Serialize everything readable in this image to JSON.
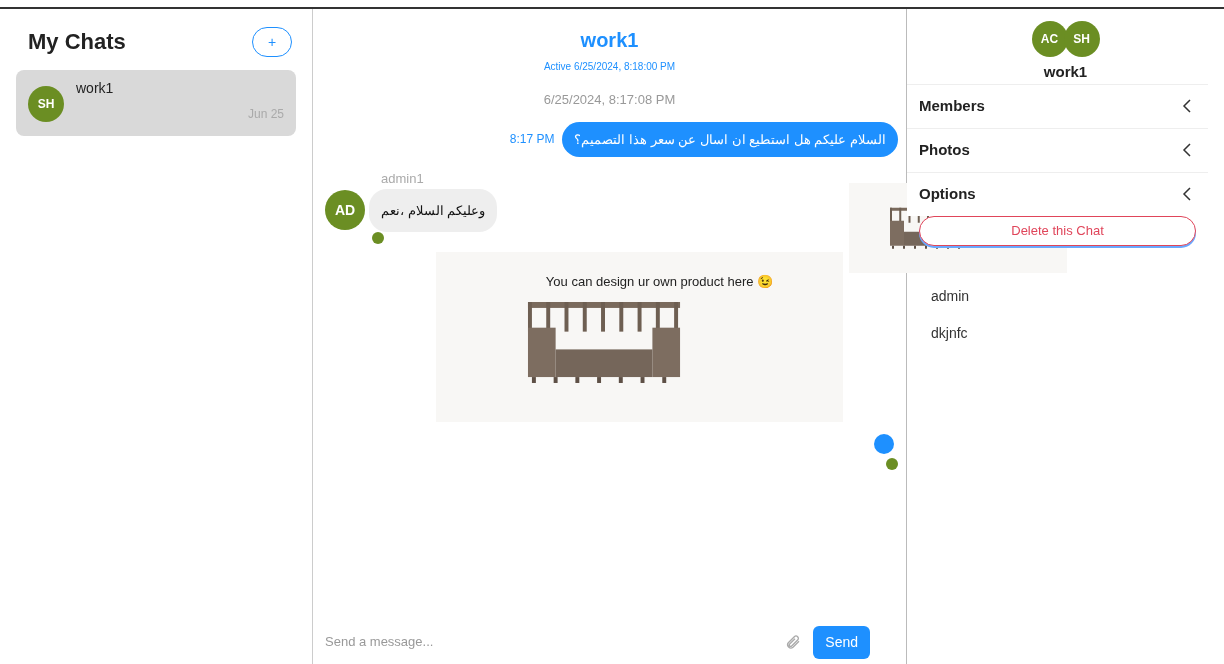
{
  "sidebar": {
    "title": "My Chats",
    "add_button": "+",
    "chats": [
      {
        "avatar": "SH",
        "name": "work1",
        "date": "Jun 25",
        "selected": true
      }
    ]
  },
  "chat": {
    "title": "work1",
    "status": "Active 6/25/2024, 8:18:00 PM",
    "messages": [
      {
        "kind": "timestamp",
        "text": "6/25/2024, 8:17:08 PM"
      },
      {
        "kind": "outgoing",
        "time": "8:17 PM",
        "text": "السلام عليكم هل استطيع ان اسال عن سعر هذا التصميم؟"
      },
      {
        "kind": "incoming",
        "sender": "admin1",
        "avatar": "AD",
        "text": "وعليكم السلام ،نعم"
      },
      {
        "kind": "image",
        "caption": "You can design ur own product here 😉"
      }
    ],
    "composer": {
      "placeholder": "Send a message...",
      "send": "Send"
    }
  },
  "details": {
    "avatars": [
      "AC",
      "SH"
    ],
    "title": "work1",
    "sections": [
      {
        "label": "Members"
      },
      {
        "label": "Photos"
      },
      {
        "label": "Options",
        "button": "Delete this Chat"
      }
    ],
    "members": [
      "admin",
      "dkjnfc"
    ]
  }
}
